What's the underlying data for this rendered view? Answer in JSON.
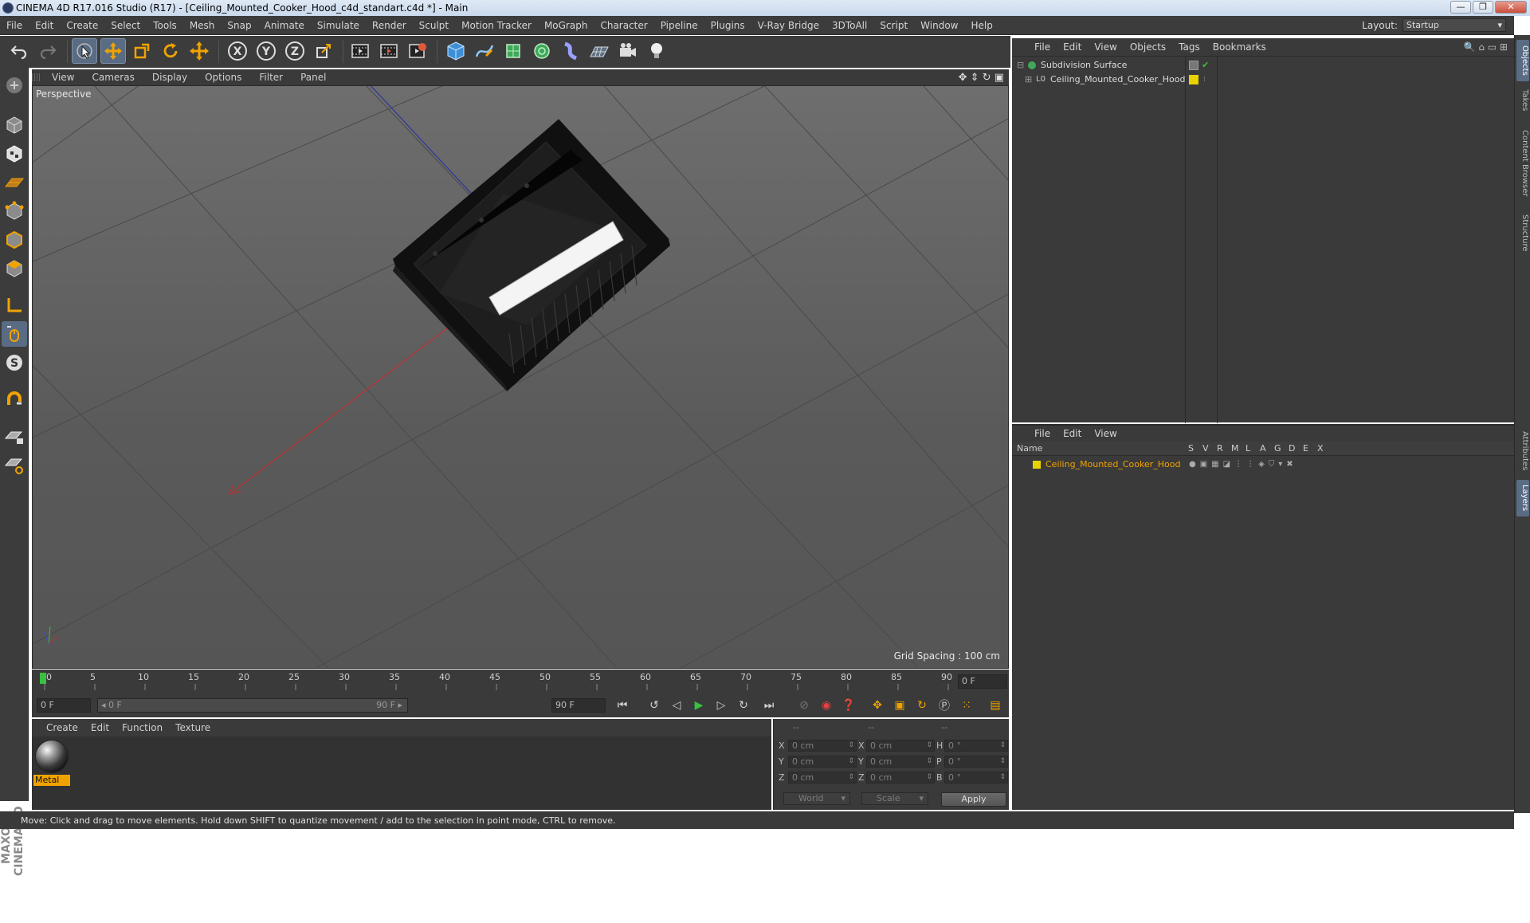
{
  "window": {
    "title": "CINEMA 4D R17.016 Studio (R17) - [Ceiling_Mounted_Cooker_Hood_c4d_standart.c4d *] - Main",
    "min": "—",
    "max": "❐",
    "close": "✕"
  },
  "menu": [
    "File",
    "Edit",
    "Create",
    "Select",
    "Tools",
    "Mesh",
    "Snap",
    "Animate",
    "Simulate",
    "Render",
    "Sculpt",
    "Motion Tracker",
    "MoGraph",
    "Character",
    "Pipeline",
    "Plugins",
    "V-Ray Bridge",
    "3DToAll",
    "Script",
    "Window",
    "Help"
  ],
  "layout": {
    "label": "Layout:",
    "value": "Startup"
  },
  "viewport": {
    "menu": [
      "View",
      "Cameras",
      "Display",
      "Options",
      "Filter",
      "Panel"
    ],
    "label": "Perspective",
    "grid_spacing": "Grid Spacing : 100 cm"
  },
  "timeline": {
    "ticks": [
      "0",
      "5",
      "10",
      "15",
      "20",
      "25",
      "30",
      "35",
      "40",
      "45",
      "50",
      "55",
      "60",
      "65",
      "70",
      "75",
      "80",
      "85",
      "90"
    ],
    "current_frame": "0 F",
    "start": "0 F",
    "range_start": "◂ 0 F",
    "range_end": "90 F ▸",
    "end": "90 F"
  },
  "material_manager": {
    "menu": [
      "Create",
      "Edit",
      "Function",
      "Texture"
    ],
    "materials": [
      {
        "name": "Metal"
      }
    ]
  },
  "coordinates": {
    "headers": [
      "--",
      "--",
      "--"
    ],
    "rows": [
      {
        "a": "X",
        "av": "0 cm",
        "b": "X",
        "bv": "0 cm",
        "c": "H",
        "cv": "0 °"
      },
      {
        "a": "Y",
        "av": "0 cm",
        "b": "Y",
        "bv": "0 cm",
        "c": "P",
        "cv": "0 °"
      },
      {
        "a": "Z",
        "av": "0 cm",
        "b": "Z",
        "bv": "0 cm",
        "c": "B",
        "cv": "0 °"
      }
    ],
    "mode1": "World",
    "mode2": "Scale",
    "apply": "Apply"
  },
  "object_manager": {
    "menu": [
      "File",
      "Edit",
      "View",
      "Objects",
      "Tags",
      "Bookmarks"
    ],
    "objects": [
      {
        "name": "Subdivision Surface"
      },
      {
        "name": "Ceiling_Mounted_Cooker_Hood"
      }
    ]
  },
  "layer_manager": {
    "menu": [
      "File",
      "Edit",
      "View"
    ],
    "columns": [
      "Name",
      "S",
      "V",
      "R",
      "M",
      "L",
      "A",
      "G",
      "D",
      "E",
      "X"
    ],
    "layers": [
      {
        "name": "Ceiling_Mounted_Cooker_Hood"
      }
    ]
  },
  "right_tabs": [
    "Objects",
    "Takes",
    "Content Browser",
    "Structure",
    "Attributes",
    "Layers"
  ],
  "status": "Move: Click and drag to move elements. Hold down SHIFT to quantize movement / add to the selection in point mode, CTRL to remove.",
  "branding": "MAXON CINEMA 4D",
  "colors": {
    "accent": "#f0a300",
    "layer_yellow": "#e8d200",
    "selected": "#5a6c84"
  }
}
